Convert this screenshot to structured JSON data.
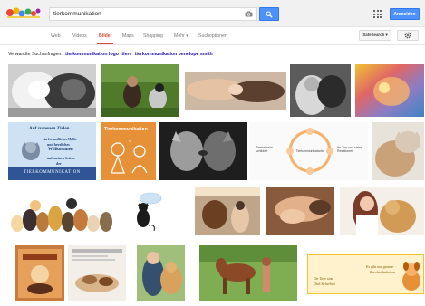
{
  "search": {
    "value": "tierkommunikation",
    "camera_icon": "camera-icon",
    "button_icon": "magnifier-icon"
  },
  "header": {
    "apps_icon": "apps-grid-icon",
    "signin_label": "Anmelden"
  },
  "tabs": [
    {
      "label": "Web"
    },
    {
      "label": "Videos"
    },
    {
      "label": "Bilder",
      "active": true
    },
    {
      "label": "Maps"
    },
    {
      "label": "Shopping"
    },
    {
      "label": "Mehr ▾"
    },
    {
      "label": "Suchoptionen"
    }
  ],
  "safesearch": {
    "label": "SafeSearch ▾"
  },
  "settings": {
    "icon": "gear-icon"
  },
  "related": {
    "prefix": "Verwandte Suchanfragen:",
    "links": [
      "tierkommunikation logo",
      "tiere",
      "tierkommunikation penelope smith"
    ]
  },
  "tiles": {
    "poster_title": "Auf zu neuen Zielen.....",
    "poster_line1": "ein freundliches Hallo",
    "poster_line2": "und herzliches",
    "poster_line3": "Willkommen",
    "poster_line4": "auf meinen Seiten",
    "poster_line5": "der",
    "poster_brand": "TIERKOMMUNIKATION",
    "orange_title": "Tierkommunikation",
    "diagram_left": "Tierhalter/in schildert",
    "diagram_right": "Ihr Tier und seine Reaktionen",
    "diagram_center": "Tierkommunikator/in",
    "yellow_line1": "Es gibt nur genaue",
    "yellow_line2": "Bescheidenheiten.",
    "yellow_line3": "Die Tiere sind",
    "yellow_line4": "Dich Sicherheit"
  },
  "colors": {
    "accent": "#4d90fe",
    "active_tab": "#dd4b39",
    "link": "#1a0dab"
  }
}
